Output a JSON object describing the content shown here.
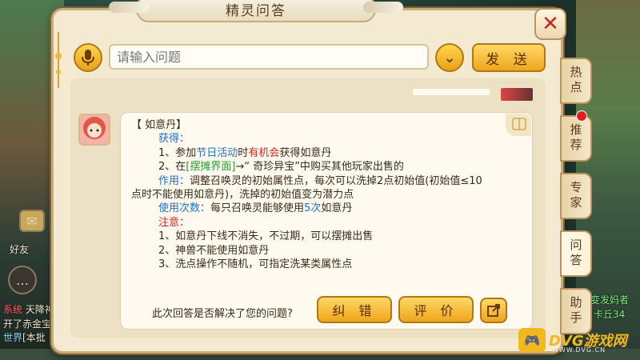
{
  "dialog": {
    "title": "精灵问答"
  },
  "query": {
    "placeholder": "请输入问题",
    "send_label": "发 送"
  },
  "answer": {
    "heading": "【 如意丹】",
    "get_label": "获得：",
    "line1_pre": "1、参加",
    "line1_event": "节日活动",
    "line1_mid": "时",
    "line1_chance": "有机会",
    "line1_post": "获得如意丹",
    "line2_pre": "2、在",
    "line2_stall": "[摆摊界面]",
    "line2_post": "→“ 奇珍异宝”中购买其他玩家出售的",
    "use_label": "作用：",
    "use_text": "调整召唤灵的初始属性点，每次可以洗掉2点初始值(初始值≤10",
    "use_text2": "点时不能使用如意丹)，洗掉的初始值变为潜力点",
    "times_label": "使用次数：",
    "times_pre": "每只召唤灵能够使用",
    "times_value": "5次",
    "times_post": "如意丹",
    "note_label": "注意：",
    "note1": "1、如意丹下线不消失，不过期，可以摆摊出售",
    "note2": "2、神兽不能使用如意丹",
    "note3": "3、洗点操作不随机，可指定洗某类属性点"
  },
  "feedback": {
    "question": "此次回答是否解决了您的问题?",
    "correct_label": "纠 错",
    "rate_label": "评 价"
  },
  "tabs": [
    "热点",
    "推荐",
    "专家",
    "问答",
    "助手"
  ],
  "left_ui": {
    "friend_label": "好友",
    "chat1_tag": "系统",
    "chat1_text": "天降神",
    "chat2_text": "开了赤金宝",
    "chat3_tag": "世界",
    "chat3_text": "[本批"
  },
  "right_ui": {
    "line1": "变发妈者",
    "line2": "卡丘34"
  },
  "watermark": {
    "brand": "DVG游戏网",
    "url": "WWW.DVG.CN"
  },
  "colors": {
    "accent_gold": "#eea61c",
    "blue_text": "#1e6ec8",
    "red_text": "#d0281c",
    "green_text": "#2c9a2c"
  }
}
